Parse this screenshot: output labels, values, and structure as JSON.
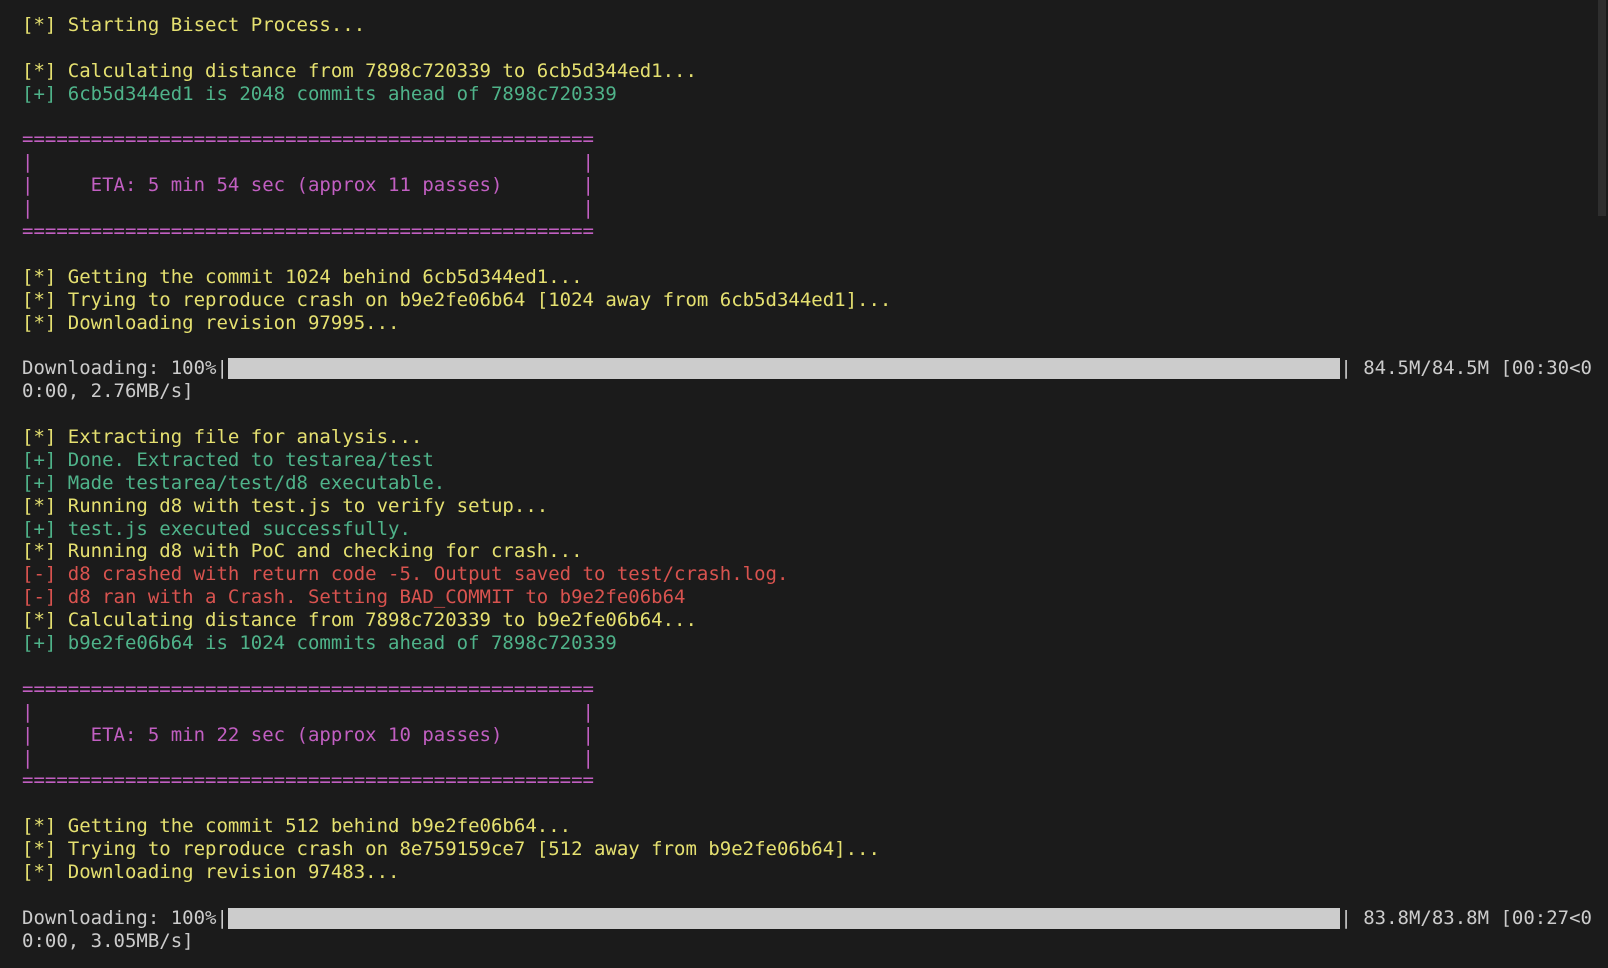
{
  "lines_block1": [
    {
      "text": "[*] Starting Bisect Process...",
      "color": "yellow"
    },
    {
      "text": "",
      "color": "gray"
    },
    {
      "text": "[*] Calculating distance from 7898c720339 to 6cb5d344ed1...",
      "color": "yellow"
    },
    {
      "text": "[+] 6cb5d344ed1 is 2048 commits ahead of 7898c720339",
      "color": "green"
    },
    {
      "text": "",
      "color": "gray"
    }
  ],
  "eta_box_1": {
    "border": "==================================================",
    "empty": "|                                                |",
    "text": "|     ETA: 5 min 54 sec (approx 11 passes)       |"
  },
  "lines_block2": [
    {
      "text": "",
      "color": "gray"
    },
    {
      "text": "[*] Getting the commit 1024 behind 6cb5d344ed1...",
      "color": "yellow"
    },
    {
      "text": "[*] Trying to reproduce crash on b9e2fe06b64 [1024 away from 6cb5d344ed1]...",
      "color": "yellow"
    },
    {
      "text": "[*] Downloading revision 97995...",
      "color": "yellow"
    },
    {
      "text": "",
      "color": "gray"
    }
  ],
  "download_1": {
    "prefix": "Downloading: 100%|",
    "suffix": "| 84.5M/84.5M [00:30<0",
    "wrap": "0:00, 2.76MB/s]",
    "progress_percent": 100
  },
  "lines_block3": [
    {
      "text": "",
      "color": "gray"
    },
    {
      "text": "[*] Extracting file for analysis...",
      "color": "yellow"
    },
    {
      "text": "[+] Done. Extracted to testarea/test",
      "color": "green"
    },
    {
      "text": "[+] Made testarea/test/d8 executable.",
      "color": "green"
    },
    {
      "text": "[*] Running d8 with test.js to verify setup...",
      "color": "yellow"
    },
    {
      "text": "[+] test.js executed successfully.",
      "color": "green"
    },
    {
      "text": "[*] Running d8 with PoC and checking for crash...",
      "color": "yellow"
    },
    {
      "text": "[-] d8 crashed with return code -5. Output saved to test/crash.log.",
      "color": "red"
    },
    {
      "text": "[-] d8 ran with a Crash. Setting BAD_COMMIT to b9e2fe06b64",
      "color": "red"
    },
    {
      "text": "[*] Calculating distance from 7898c720339 to b9e2fe06b64...",
      "color": "yellow"
    },
    {
      "text": "[+] b9e2fe06b64 is 1024 commits ahead of 7898c720339",
      "color": "green"
    },
    {
      "text": "",
      "color": "gray"
    }
  ],
  "eta_box_2": {
    "border": "==================================================",
    "empty": "|                                                |",
    "text": "|     ETA: 5 min 22 sec (approx 10 passes)       |"
  },
  "lines_block4": [
    {
      "text": "",
      "color": "gray"
    },
    {
      "text": "[*] Getting the commit 512 behind b9e2fe06b64...",
      "color": "yellow"
    },
    {
      "text": "[*] Trying to reproduce crash on 8e759159ce7 [512 away from b9e2fe06b64]...",
      "color": "yellow"
    },
    {
      "text": "[*] Downloading revision 97483...",
      "color": "yellow"
    },
    {
      "text": "",
      "color": "gray"
    }
  ],
  "download_2": {
    "prefix": "Downloading: 100%|",
    "suffix": "| 83.8M/83.8M [00:27<0",
    "wrap": "0:00, 3.05MB/s]",
    "progress_percent": 100
  },
  "colors": {
    "background": "#1b1b1b",
    "yellow": "#e5e070",
    "green": "#4fb38a",
    "red": "#d9534f",
    "purple": "#c25fc2",
    "gray": "#cccccc"
  }
}
